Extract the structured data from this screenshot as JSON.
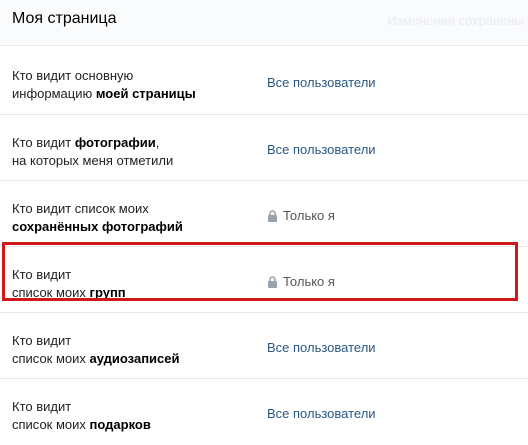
{
  "header": {
    "title": "Моя страница",
    "status": "Изменения сохранены"
  },
  "rows": [
    {
      "line1": "Кто видит основную",
      "line2_prefix": "информацию ",
      "line2_bold": "моей страницы",
      "value": "Все пользователи",
      "locked": false
    },
    {
      "line1_prefix": "Кто видит ",
      "line1_bold": "фотографии",
      "line1_suffix": ",",
      "line2": "на которых меня отметили",
      "value": "Все пользователи",
      "locked": false
    },
    {
      "line1": "Кто видит список моих",
      "line2_bold": "сохранённых фотографий",
      "value": "Только я",
      "locked": true
    },
    {
      "line1": "Кто видит",
      "line2_prefix": "список моих ",
      "line2_bold": "групп",
      "value": "Только я",
      "locked": true
    },
    {
      "line1": "Кто видит",
      "line2_prefix": "список моих ",
      "line2_bold": "аудиозаписей",
      "value": "Все пользователи",
      "locked": false
    },
    {
      "line1": "Кто видит",
      "line2_prefix": "список моих ",
      "line2_bold": "подарков",
      "value": "Все пользователи",
      "locked": false
    }
  ],
  "colors": {
    "link": "#2a5885",
    "highlight": "#d01818"
  },
  "icons": {
    "lock": "lock-icon"
  }
}
